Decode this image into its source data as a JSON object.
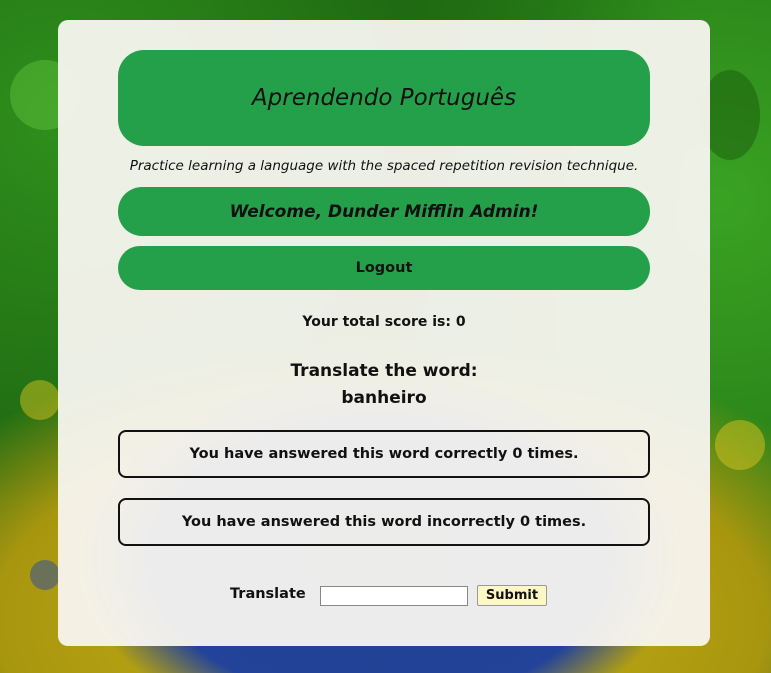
{
  "header": {
    "title": "Aprendendo Português",
    "tagline": "Practice learning a language with the spaced repetition revision technique."
  },
  "user": {
    "welcome": "Welcome, Dunder Mifflin Admin!",
    "logout_label": "Logout"
  },
  "score": {
    "text": "Your total score is: 0"
  },
  "word": {
    "prompt": "Translate the word:",
    "current": "banheiro",
    "correct_text": "You have answered this word correctly 0 times.",
    "incorrect_text": "You have answered this word incorrectly 0 times."
  },
  "form": {
    "label": "Translate",
    "input_value": "",
    "submit_label": "Submit"
  },
  "colors": {
    "accent_green": "#25a04a",
    "submit_bg": "#fcf7c4"
  }
}
